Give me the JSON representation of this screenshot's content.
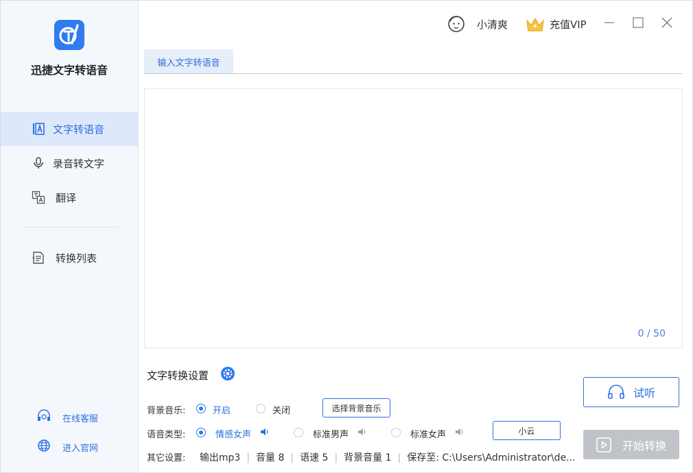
{
  "app": {
    "name": "迅捷文字转语音"
  },
  "nav": {
    "items": [
      {
        "label": "文字转语音"
      },
      {
        "label": "录音转文字"
      },
      {
        "label": "翻译"
      },
      {
        "label": "转换列表"
      }
    ],
    "active_index": 0
  },
  "side_links": {
    "service": "在线客服",
    "website": "进入官网"
  },
  "header": {
    "username": "小清爽",
    "vip_label": "充值VIP"
  },
  "tab": {
    "label": "输入文字转语音"
  },
  "editor": {
    "text": "",
    "counter": "0 / 50"
  },
  "settings": {
    "title": "文字转换设置",
    "bg_music": {
      "label": "背景音乐:",
      "options": [
        "开启",
        "关闭"
      ],
      "selected": "开启",
      "choose_button": "选择背景音乐"
    },
    "voice_type": {
      "label": "语音类型:",
      "options": [
        "情感女声",
        "标准男声",
        "标准女声"
      ],
      "selected": "情感女声",
      "voice_button": "小云"
    },
    "other": {
      "label": "其它设置:",
      "format": "输出mp3",
      "volume": "音量 8",
      "speed": "语速 5",
      "bg_volume": "背景音量 1",
      "save_to": "保存至: C:\\Users\\Administrator\\de..."
    }
  },
  "buttons": {
    "listen": "试听",
    "start": "开始转换"
  },
  "colors": {
    "accent": "#2f7bf0",
    "sidebar_bg": "#f4f8fd",
    "active_nav_bg": "#dde9fb",
    "disabled": "#c0c4c9"
  }
}
